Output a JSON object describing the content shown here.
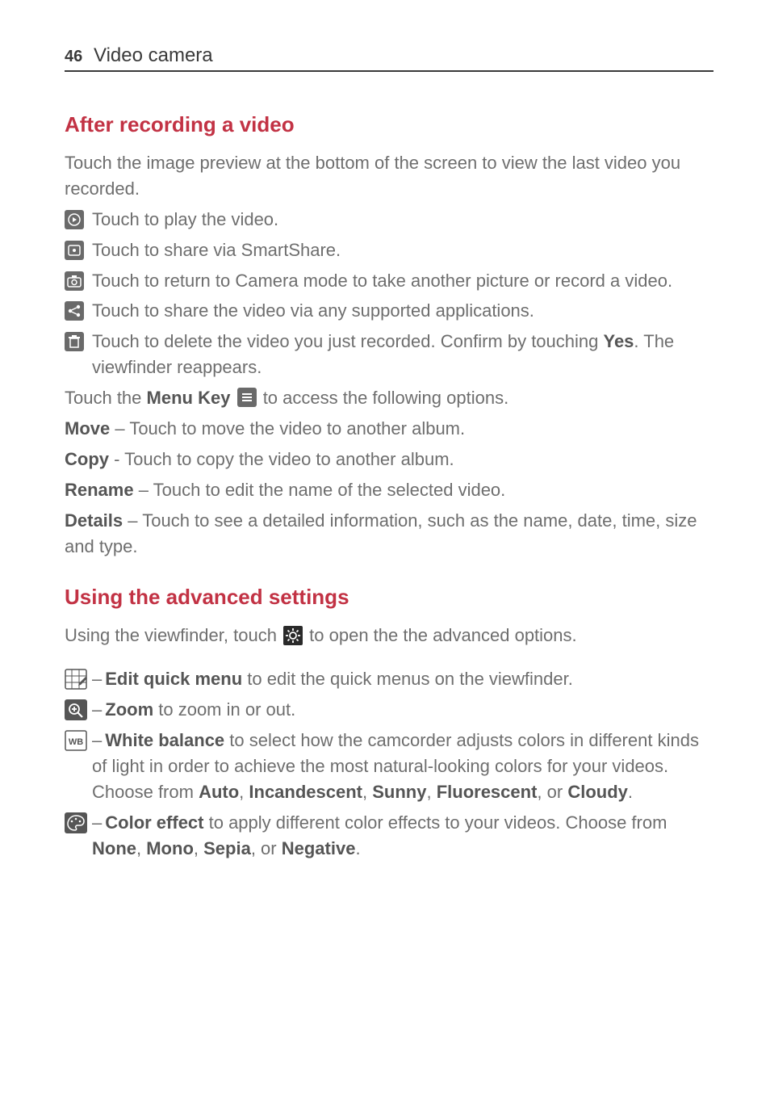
{
  "header": {
    "page_number": "46",
    "chapter_title": "Video camera"
  },
  "section1": {
    "heading": "After recording a video",
    "intro": "Touch the image preview at the bottom of the screen to view the last video you recorded.",
    "items": {
      "play": "Touch to play the video.",
      "share_smart": "Touch to share via SmartShare.",
      "camera": "Touch to return to Camera mode to take another picture or record a video.",
      "share_apps": "Touch to share the video via any supported applications.",
      "delete_pre": "Touch to delete the video you just recorded. Confirm by touching ",
      "delete_yes": "Yes",
      "delete_post": ". The viewfinder reappears."
    },
    "menu_line_pre": "Touch the ",
    "menu_key_label": "Menu Key",
    "menu_line_post": " to access the following options.",
    "options": {
      "move_label": "Move",
      "move_text": " – Touch to move the video to another album.",
      "copy_label": "Copy",
      "copy_text": " - Touch to copy the video to another album.",
      "rename_label": "Rename",
      "rename_text": " – Touch to edit the name of the selected video.",
      "details_label": "Details",
      "details_text": " – Touch to see a detailed information, such as the name, date, time, size and type."
    }
  },
  "section2": {
    "heading": "Using the advanced settings",
    "intro_pre": "Using the viewfinder, touch ",
    "intro_post": " to open the the advanced options.",
    "items": {
      "edit_label": "Edit quick menu",
      "edit_text": " to edit the quick menus on the viewfinder.",
      "zoom_label": "Zoom",
      "zoom_text": " to zoom in or out.",
      "wb_label": "White balance",
      "wb_text_1": " to select how the camcorder adjusts colors in different kinds of light in order to achieve the most natural-looking colors for your videos. Choose from ",
      "wb_auto": "Auto",
      "wb_incand": "Incandescent",
      "wb_sunny": "Sunny",
      "wb_fluor": "Fluorescent",
      "wb_cloudy": "Cloudy",
      "color_label": "Color effect",
      "color_text_1": " to apply different color effects to your videos. Choose from ",
      "color_none": "None",
      "color_mono": "Mono",
      "color_sepia": "Sepia",
      "color_negative": "Negative"
    }
  },
  "punct": {
    "comma_sp": ", ",
    "or_sp": ", or ",
    "period": "."
  }
}
